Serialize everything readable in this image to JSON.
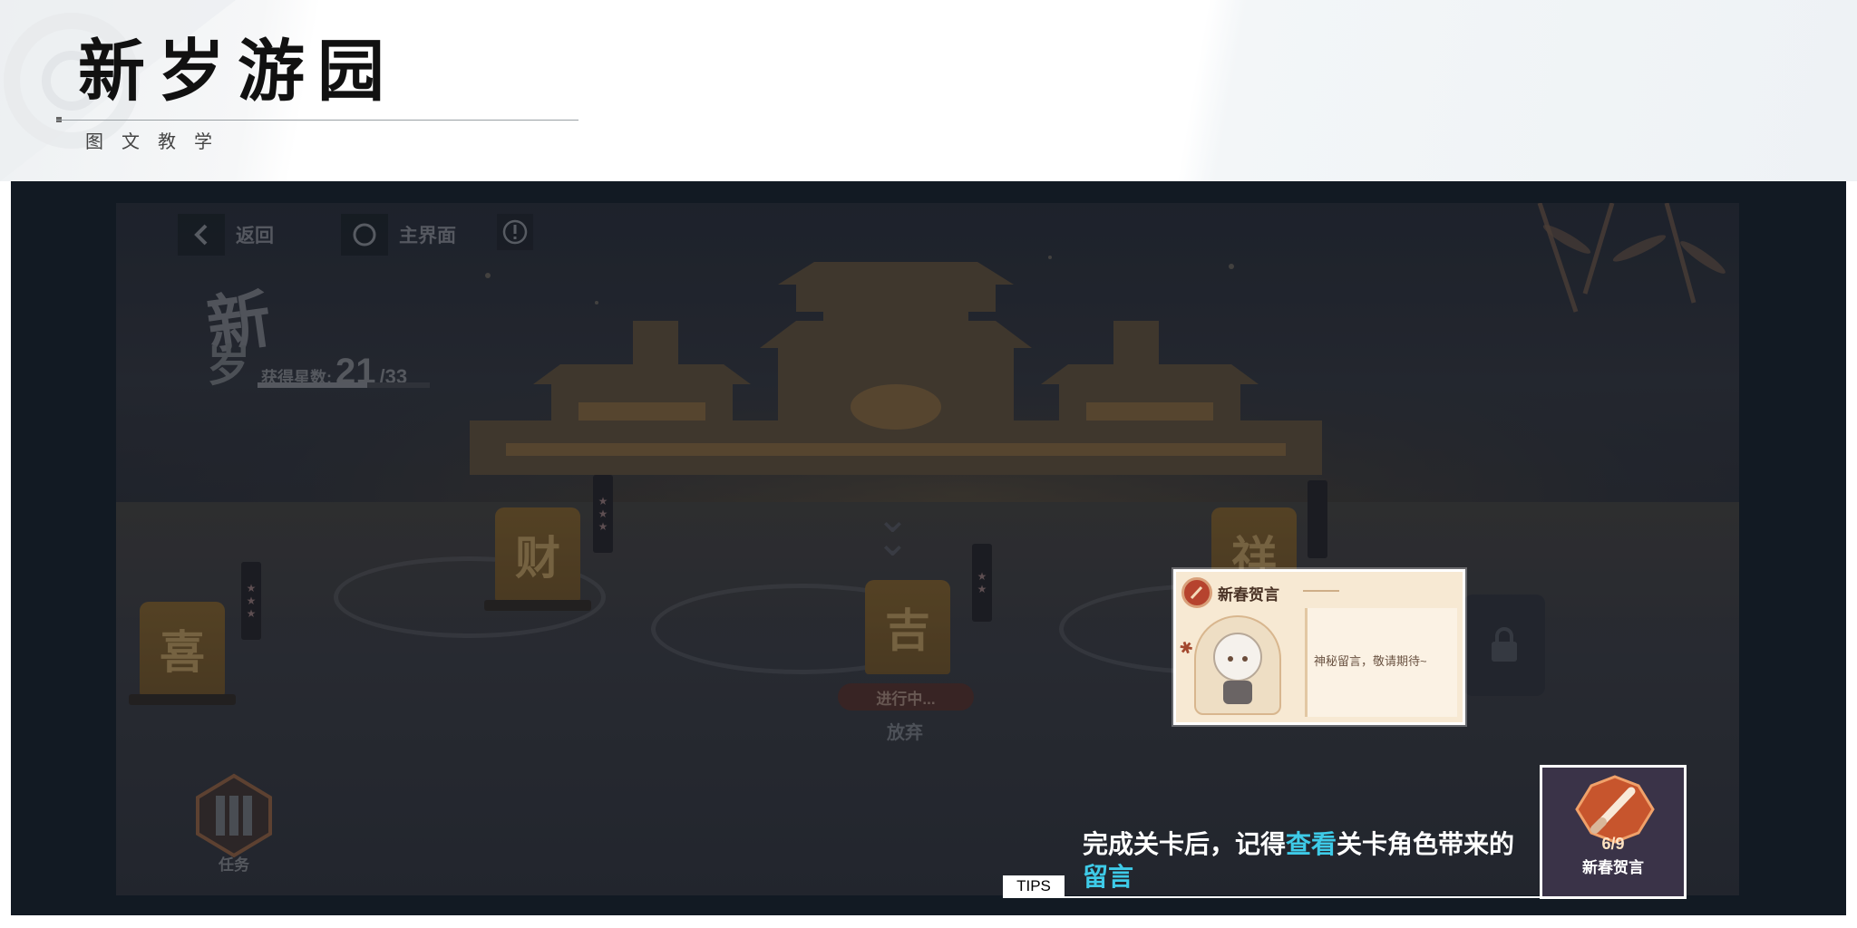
{
  "header": {
    "title": "新岁游园",
    "subtitle": "图文教学"
  },
  "game": {
    "nav": {
      "back_label": "返回",
      "home_label": "主界面"
    },
    "logo": {
      "line1": "新",
      "line2": "岁"
    },
    "stars": {
      "label": "获得星数:",
      "current": "21",
      "total": "/33",
      "fraction": 0.636
    },
    "stages": [
      {
        "char": "喜"
      },
      {
        "char": "财"
      },
      {
        "char": "吉"
      },
      {
        "char": "祥"
      }
    ],
    "current_stage": {
      "status": "进行中...",
      "abandon_label": "放弃"
    },
    "task": {
      "label": "任务"
    },
    "greeting_card": {
      "title": "新春贺言",
      "message": "神秘留言，敬请期待~"
    },
    "collection": {
      "count": "6/9",
      "label": "新春贺言"
    }
  },
  "tips": {
    "label": "TIPS",
    "text_part1": "完成关卡后，记得",
    "text_hl1": "查看",
    "text_part2": "关卡角色带来的",
    "text_hl2": "留言"
  },
  "colors": {
    "highlight": "#3ecbe8",
    "frame": "#121a23",
    "card": "#f7e9d3"
  }
}
